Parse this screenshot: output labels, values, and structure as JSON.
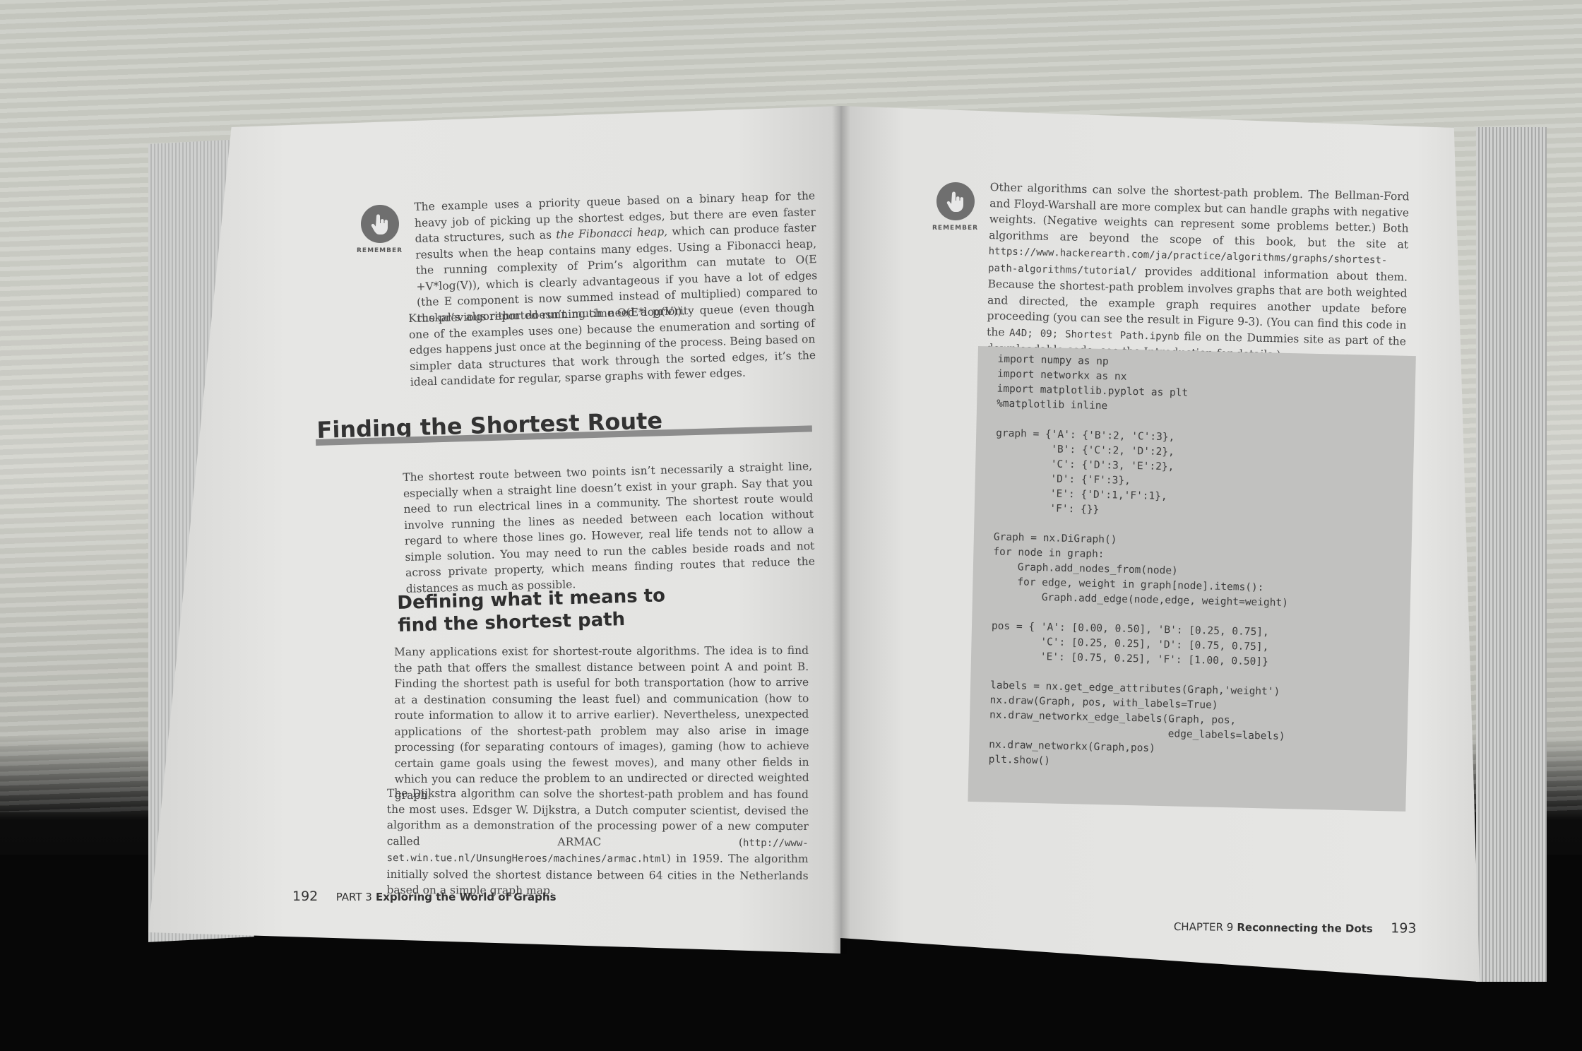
{
  "left_page": {
    "remember_label": "REMEMBER",
    "remember_text_1": "The example uses a priority queue based on a binary heap for the heavy job of picking up the shortest edges, but there are even faster data structures, such as ",
    "remember_text_em": "the Fibonacci heap,",
    "remember_text_2": " which can produce faster results when the heap contains many edges. Using a Fibonacci heap, the running complexity of Prim’s algorithm can mutate to O(E +V*log(V)), which is clearly advantageous if you have a lot of edges (the E component is now summed instead of multiplied) compared to the previous reported running time O(E*log(V)).",
    "kruskal_paragraph": "Kruskal’s algorithm doesn’t much need a priority queue (even though one of the examples uses one) because the enumeration and sorting of edges happens just once at the beginning of the process. Being based on simpler data structures that work through the sorted edges, it’s the ideal candidate for regular, sparse graphs with fewer edges.",
    "section_heading": "Finding the Shortest Route",
    "section_paragraph": "The shortest route between two points isn’t necessarily a straight line, especially when a straight line doesn’t exist in your graph. Say that you need to run electrical lines in a community. The shortest route would involve running the lines as needed between each location without regard to where those lines go. However, real life tends not to allow a simple solution. You may need to run the cables beside roads and not across private property, which means finding routes that reduce the distances as much as possible.",
    "subheading_line1": "Defining what it means to",
    "subheading_line2": "find the shortest path",
    "subsection_paragraph": "Many applications exist for shortest-route algorithms. The idea is to find the path that offers the smallest distance between point A and point B. Finding the shortest path is useful for both transportation (how to arrive at a destination consuming the least fuel) and communication (how to route information to allow it to arrive earlier). Nevertheless, unexpected applications of the shortest-path problem may also arise in image processing (for separating contours of images), gaming (how to achieve certain game goals using the fewest moves), and many other fields in which you can reduce the problem to an undirected or directed weighted graph.",
    "dijkstra_text_1": "The Dijkstra algorithm can solve the shortest-path problem and has found the most uses. Edsger W. Dijkstra, a Dutch computer scientist, devised the algorithm as a demonstration of the processing power of a new computer called ARMAC (",
    "dijkstra_url": "http://www-set.win.tue.nl/UnsungHeroes/machines/armac.html",
    "dijkstra_text_2": ") in 1959. The algorithm initially solved the shortest distance between 64 cities in the Netherlands based on a simple graph map.",
    "page_number": "192",
    "footer_part": "PART 3",
    "footer_title": "Exploring the World of Graphs"
  },
  "right_page": {
    "remember_label": "REMEMBER",
    "remember_text_1": "Other algorithms can solve the shortest-path problem. The Bellman-Ford and Floyd-Warshall are more complex but can handle graphs with negative weights. (Negative weights can represent some problems better.) Both algorithms are beyond the scope of this book, but the site at ",
    "remember_url": "https://www.hackerearth.com/ja/practice/algorithms/graphs/shortest-path-algorithms/tutorial/",
    "remember_text_2": " provides additional information about them. Because the shortest-path problem involves graphs that are both weighted and directed, the example graph requires another update before proceeding (you can see the result in Figure 9-3). (You can find this code in the ",
    "remember_code_ref": "A4D; 09; Shortest Path.ipynb",
    "remember_text_3": " file on the Dummies site as part of the downloadable code; see the Introduction for details.)",
    "code_listing": "import numpy as np\nimport networkx as nx\nimport matplotlib.pyplot as plt\n%matplotlib inline\n\ngraph = {'A': {'B':2, 'C':3},\n         'B': {'C':2, 'D':2},\n         'C': {'D':3, 'E':2},\n         'D': {'F':3},\n         'E': {'D':1,'F':1},\n         'F': {}}\n\nGraph = nx.DiGraph()\nfor node in graph:\n    Graph.add_nodes_from(node)\n    for edge, weight in graph[node].items():\n        Graph.add_edge(node,edge, weight=weight)\n\npos = { 'A': [0.00, 0.50], 'B': [0.25, 0.75],\n        'C': [0.25, 0.25], 'D': [0.75, 0.75],\n        'E': [0.75, 0.25], 'F': [1.00, 0.50]}\n\nlabels = nx.get_edge_attributes(Graph,'weight')\nnx.draw(Graph, pos, with_labels=True)\nnx.draw_networkx_edge_labels(Graph, pos,\n                             edge_labels=labels)\nnx.draw_networkx(Graph,pos)\nplt.show()",
    "footer_chapter": "CHAPTER 9",
    "footer_title": "Reconnecting the Dots",
    "page_number": "193"
  },
  "icons": {
    "remember": "pointing-hand-icon"
  }
}
